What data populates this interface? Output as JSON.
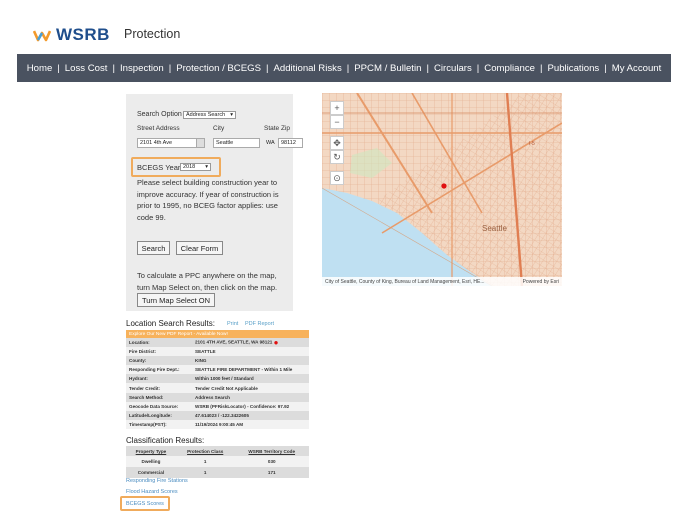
{
  "brand": {
    "logo_text": "WSRB",
    "page_title": "Protection"
  },
  "nav": {
    "items": [
      "Home",
      "Loss Cost",
      "Inspection",
      "Protection / BCEGS",
      "Additional Risks",
      "PPCM / Bulletin",
      "Circulars",
      "Compliance",
      "Publications",
      "My Account"
    ]
  },
  "search": {
    "option_label": "Search Option",
    "option_value": "Address Search",
    "street_label": "Street Address",
    "city_label": "City",
    "state_zip_label": "State Zip",
    "street_value": "2101 4th Ave",
    "city_value": "Seattle",
    "state_value": "WA",
    "zip_value": "98112",
    "bcegs_label": "BCEGS Year",
    "bcegs_value": "2018",
    "help_text": "Please select building construction year to improve accuracy. If year of construction is prior to 1995, no BCEG factor applies: use code 99.",
    "search_button": "Search",
    "clear_button": "Clear Form",
    "ppc_text": "To calculate a PPC anywhere on the map, turn Map Select on, then click on the map.",
    "map_select_button": "Turn Map Select ON"
  },
  "map": {
    "attribution": "City of Seattle, County of King, Bureau of Land Management, Esri, HE...",
    "powered_by": "Powered by Esri",
    "label_seattle": "Seattle",
    "label_i5": "I-5",
    "zoom_in": "+",
    "zoom_out": "−"
  },
  "results": {
    "title": "Location Search Results:",
    "print_link": "Print",
    "pdf_link": "PDF Report",
    "banner": "Explore Our New PDF Report - Available Now!",
    "rows": [
      {
        "k": "Location:",
        "v": "2101 4TH AVE, SEATTLE, WA 98121"
      },
      {
        "k": "Fire District:",
        "v": "SEATTLE"
      },
      {
        "k": "County:",
        "v": "KING"
      },
      {
        "k": "Responding Fire Dept.:",
        "v": "SEATTLE FIRE DEPARTMENT - Within 1 Mile"
      },
      {
        "k": "Hydrant:",
        "v": "Within 1000 feet / Standard"
      },
      {
        "k": "Tender Credit:",
        "v": "Tender Credit Not Applicable"
      },
      {
        "k": "Search Method:",
        "v": "Address Search"
      },
      {
        "k": "Geocode Data Source:",
        "v": "WSRB (PFRiskLocator) - Confidence: 97.92"
      },
      {
        "k": "Latitude/Longitude:",
        "v": "47.614023 / -122.3422605"
      },
      {
        "k": "Timestamp(PST):",
        "v": "11/19/2024 9:00:45 AM"
      }
    ]
  },
  "classification": {
    "title": "Classification Results:",
    "headers": [
      "Property Type",
      "Protection Class",
      "WSRB Territory Code"
    ],
    "rows": [
      [
        "Dwelling",
        "1",
        "030"
      ],
      [
        "Commercial",
        "1",
        "171"
      ]
    ]
  },
  "footer_links": {
    "fire_stations": "Responding Fire Stations",
    "flood": "Flood Hazard Scores",
    "bcegs": "BCEGS Scores"
  },
  "colors": {
    "nav_bg": "#4a5260",
    "highlight": "#f0ab5c",
    "brand": "#1f4e8c",
    "banner": "#f7b25c"
  }
}
